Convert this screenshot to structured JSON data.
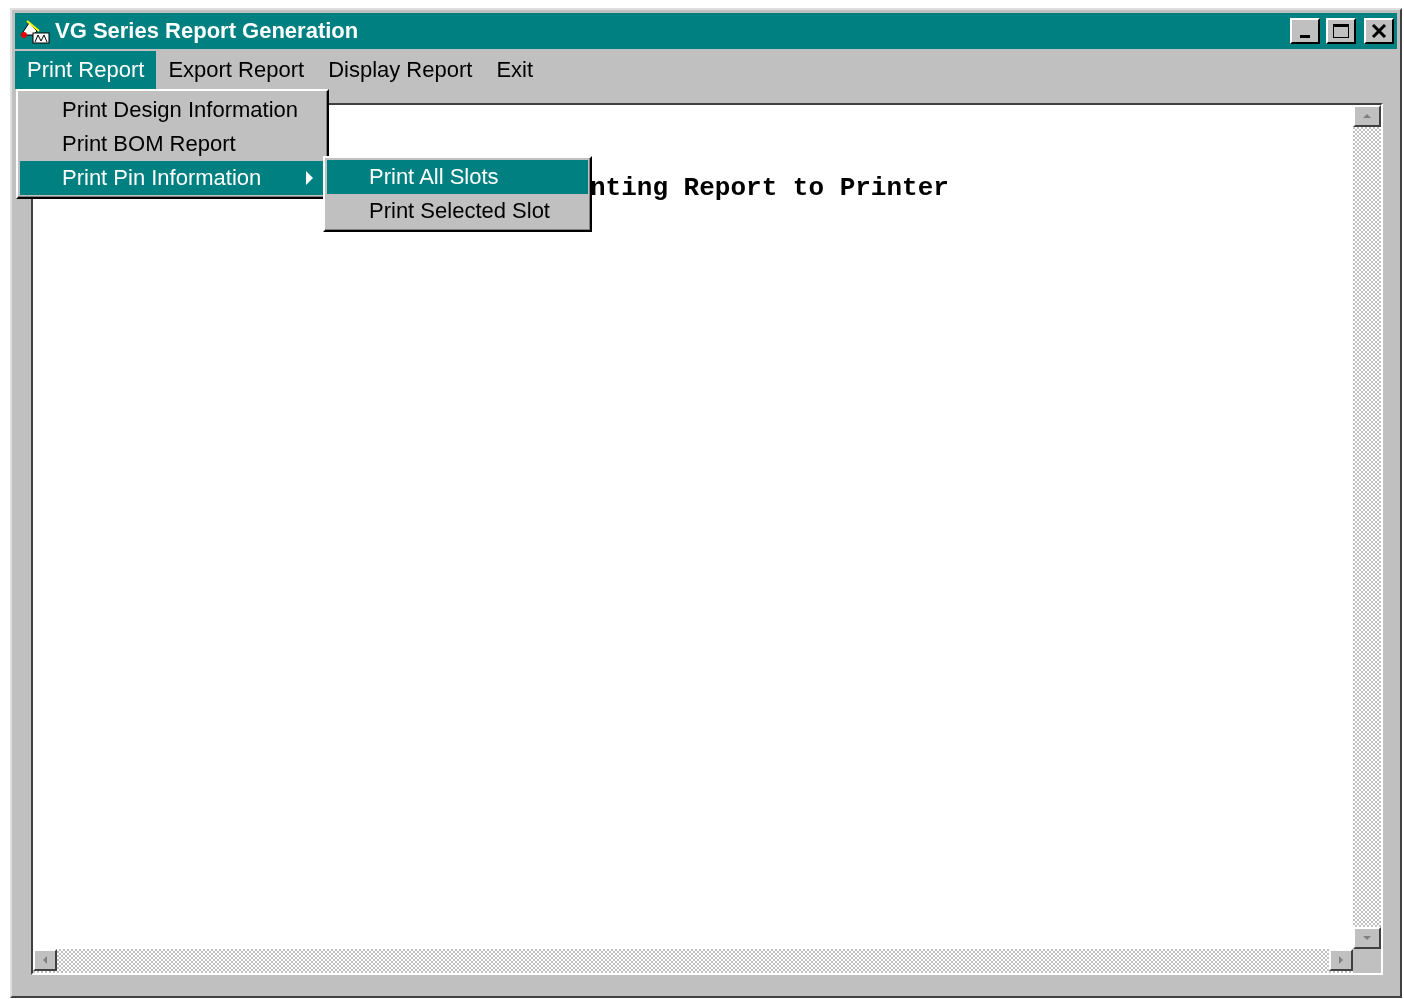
{
  "window": {
    "title": "VG Series Report Generation"
  },
  "menu_bar": [
    {
      "label": "Print Report",
      "selected": true
    },
    {
      "label": "Export Report",
      "selected": false
    },
    {
      "label": "Display Report",
      "selected": false
    },
    {
      "label": "Exit",
      "selected": false
    }
  ],
  "dropdown": {
    "items": [
      {
        "label": "Print Design Information",
        "selected": false,
        "has_submenu": false
      },
      {
        "label": "Print BOM Report",
        "selected": false,
        "has_submenu": false
      },
      {
        "label": "Print Pin Information",
        "selected": true,
        "has_submenu": true
      }
    ]
  },
  "submenu": {
    "items": [
      {
        "label": "Print All Slots",
        "selected": true
      },
      {
        "label": "Print Selected Slot",
        "selected": false
      }
    ]
  },
  "content": {
    "text": "nting Report to Printer"
  }
}
